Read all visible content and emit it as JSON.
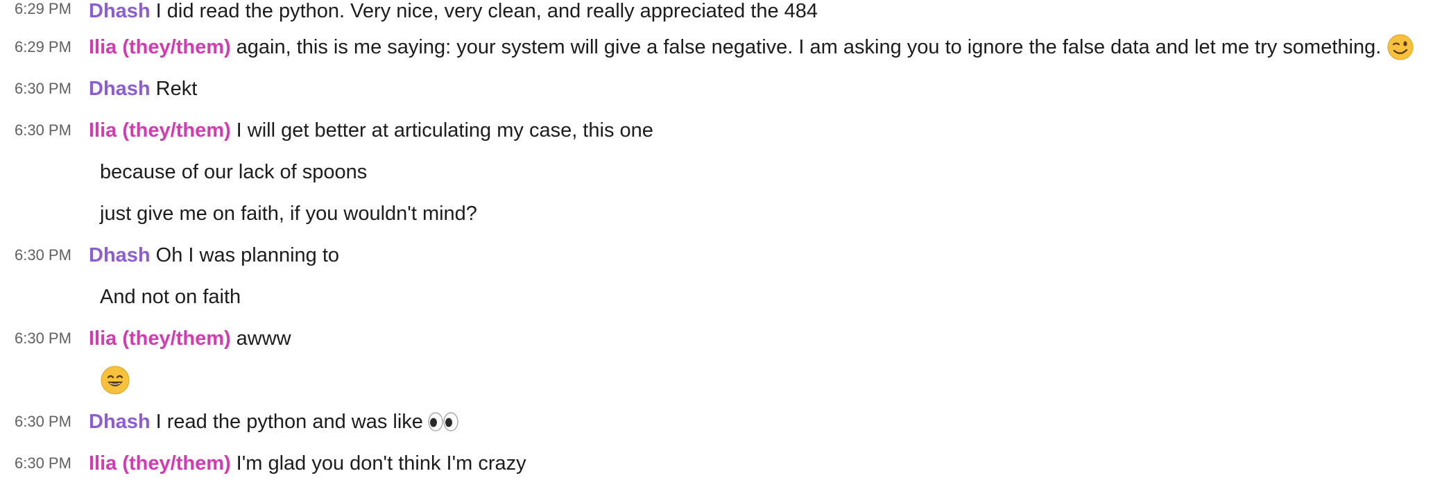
{
  "colors": {
    "dhash": "#8b5cd6",
    "ilia": "#d63ab2",
    "timestamp": "#616061",
    "text": "#1d1c1d"
  },
  "messages": [
    {
      "time": "6:29 PM",
      "author": "Dhash",
      "text": "I did read the python. Very nice, very clean, and really appreciated the 484"
    },
    {
      "time": "6:29 PM",
      "author": "Ilia (they/them)",
      "text": "again, this is me saying: your system will give a false negative. I am asking you to ignore the false data and let me try something.",
      "emoji": "wink-emoji"
    },
    {
      "time": "6:30 PM",
      "author": "Dhash",
      "text": "Rekt"
    },
    {
      "time": "6:30 PM",
      "author": "Ilia (they/them)",
      "text": "I will get better at articulating my case, this one"
    },
    {
      "text": "because of our lack of spoons"
    },
    {
      "text": "just give me on faith, if you wouldn't mind?"
    },
    {
      "time": "6:30 PM",
      "author": "Dhash",
      "text": "Oh I was planning to"
    },
    {
      "text": "And not on faith"
    },
    {
      "time": "6:30 PM",
      "author": "Ilia (they/them)",
      "text": "awww"
    },
    {
      "emoji": "smile-emoji"
    },
    {
      "time": "6:30 PM",
      "author": "Dhash",
      "text": "I read the python and was like",
      "emoji": "eyes-emoji"
    },
    {
      "time": "6:30 PM",
      "author": "Ilia (they/them)",
      "text": "I'm glad you don't think I'm crazy"
    }
  ]
}
